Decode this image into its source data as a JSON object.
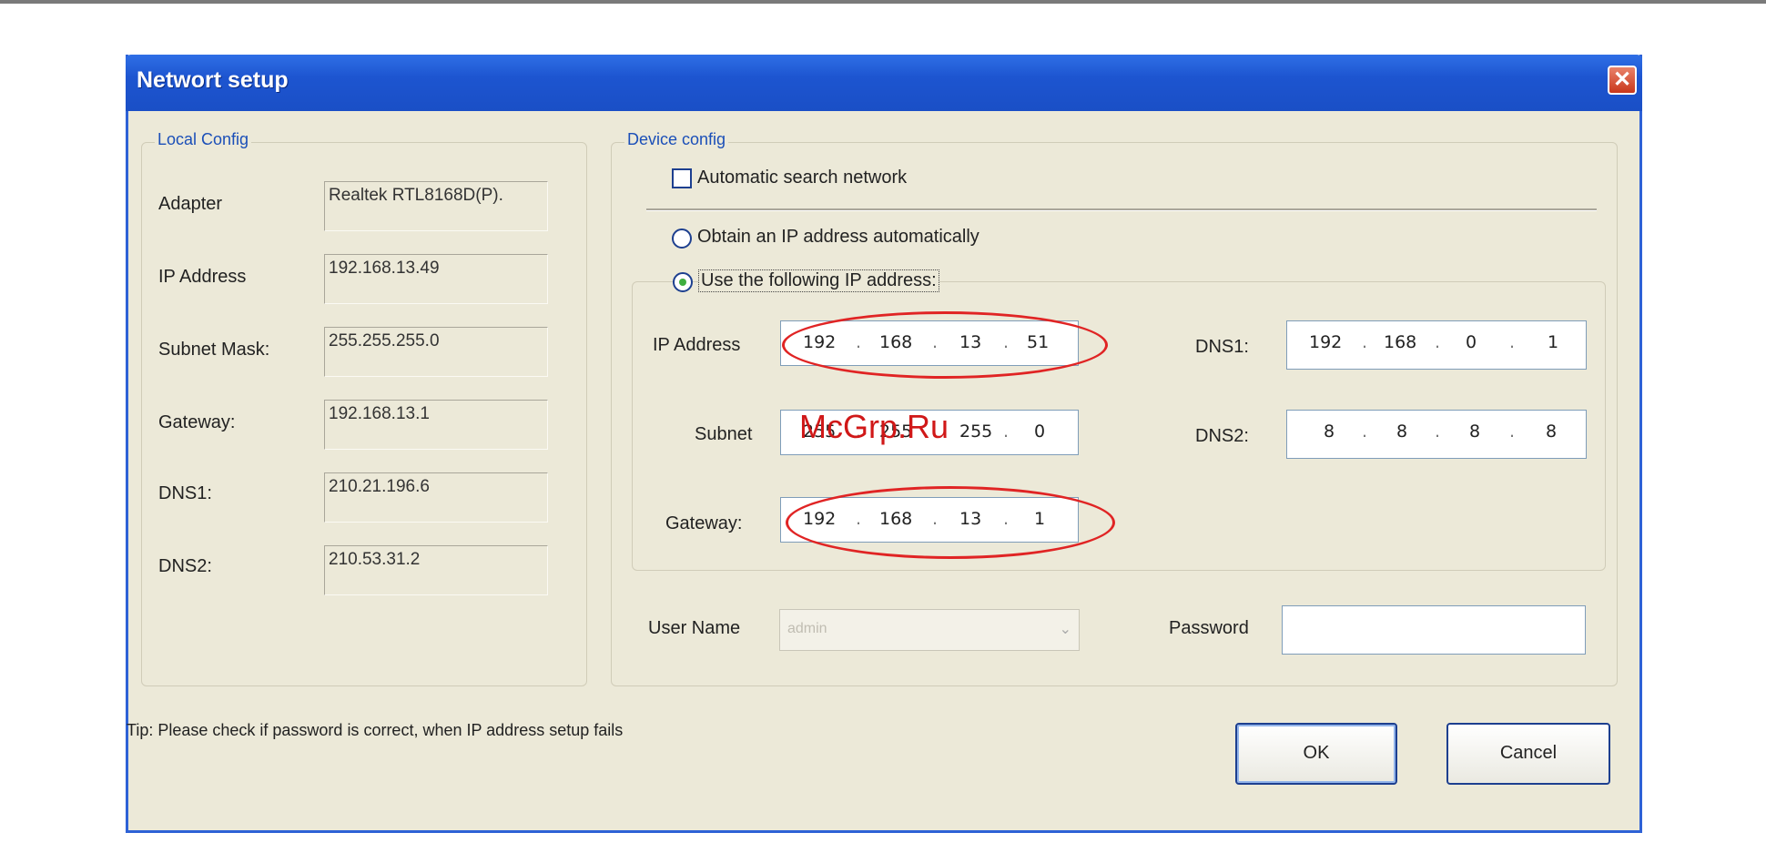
{
  "window": {
    "title": "Networt setup",
    "close_glyph": "✕"
  },
  "local_config": {
    "group_label": "Local Config",
    "fields": [
      {
        "label": "Adapter",
        "value": "Realtek RTL8168D(P)."
      },
      {
        "label": "IP Address",
        "value": "192.168.13.49"
      },
      {
        "label": "Subnet Mask:",
        "value": "255.255.255.0"
      },
      {
        "label": "Gateway:",
        "value": "192.168.13.1"
      },
      {
        "label": "DNS1:",
        "value": "210.21.196.6"
      },
      {
        "label": "DNS2:",
        "value": "210.53.31.2"
      }
    ]
  },
  "device_config": {
    "group_label": "Device config",
    "auto_search": {
      "label": "Automatic search network",
      "checked": false
    },
    "obtain_auto": {
      "label": "Obtain an IP address automatically",
      "selected": false
    },
    "use_following": {
      "label": "Use the following IP address:",
      "selected": true
    },
    "ip_address": {
      "label": "IP Address",
      "octets": [
        "192",
        "168",
        "13",
        "51"
      ]
    },
    "subnet": {
      "label": "Subnet",
      "octets": [
        "255",
        "255",
        "255",
        "0"
      ]
    },
    "gateway": {
      "label": "Gateway:",
      "octets": [
        "192",
        "168",
        "13",
        "1"
      ]
    },
    "dns1": {
      "label": "DNS1:",
      "octets": [
        "192",
        "168",
        "0",
        "1"
      ]
    },
    "dns2": {
      "label": "DNS2:",
      "octets": [
        "8",
        "8",
        "8",
        "8"
      ]
    },
    "user_name": {
      "label": "User Name",
      "value": "admin"
    },
    "password": {
      "label": "Password",
      "value": ""
    }
  },
  "tip": "Tip:  Please check if password is correct, when IP address setup fails",
  "buttons": {
    "ok": "OK",
    "cancel": "Cancel"
  },
  "watermark": "McGrp.Ru",
  "colors": {
    "title_bar": "#1d55d0",
    "window_bg": "#ece9d8",
    "highlight_ellipse": "#e02424"
  }
}
